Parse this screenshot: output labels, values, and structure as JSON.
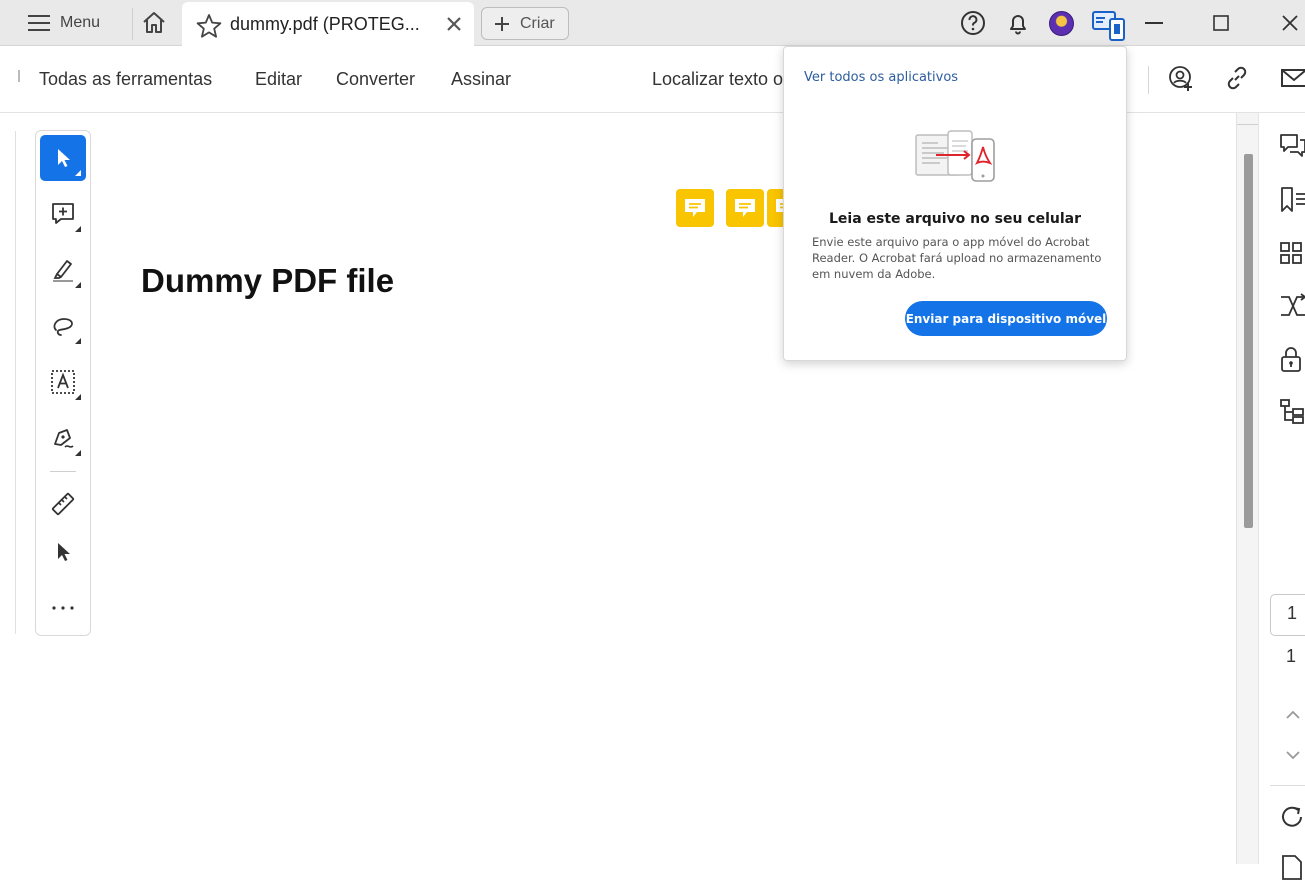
{
  "titlebar": {
    "menu_label": "Menu",
    "tab_title": "dummy.pdf (PROTEG...",
    "create_label": "Criar"
  },
  "toolbar": {
    "items": [
      "Todas as ferramentas",
      "Editar",
      "Converter",
      "Assinar"
    ],
    "search_label": "Localizar texto o"
  },
  "document": {
    "title": "Dummy PDF file",
    "sticky_note_count": 3
  },
  "popover": {
    "link": "Ver todos os aplicativos",
    "heading": "Leia este arquivo no seu celular",
    "description": "Envie este arquivo para o app móvel do Acrobat Reader. O Acrobat fará upload no armazenamento em nuvem da Adobe.",
    "button": "Enviar para dispositivo móvel"
  },
  "pagination": {
    "current_page": "1",
    "total_pages": "1"
  },
  "colors": {
    "accent": "#1473e6",
    "sticky": "#f9c400",
    "link": "#2b5d9f",
    "pdf_red": "#e0242b"
  }
}
